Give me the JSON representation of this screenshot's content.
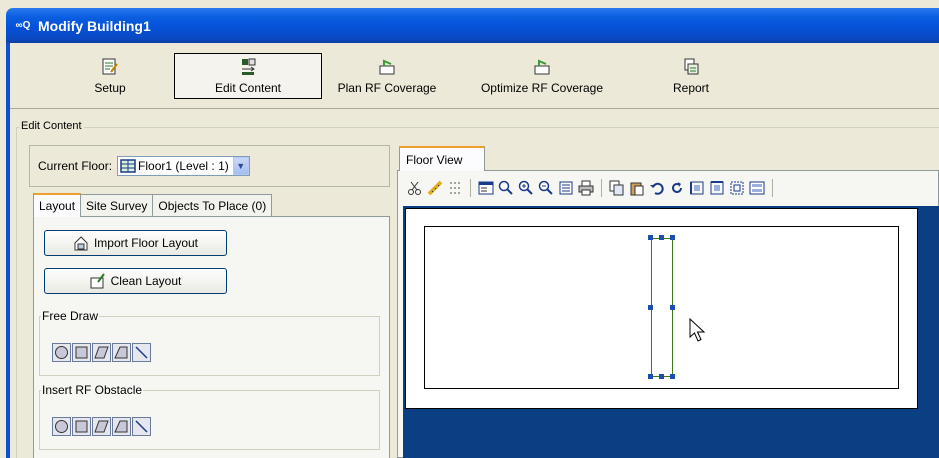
{
  "window": {
    "title": "Modify Building1",
    "app_icon": "network-app-icon",
    "app_icon_glyph": "∞Q"
  },
  "toolbar": {
    "items": [
      {
        "label": "Setup",
        "icon": "setup-icon"
      },
      {
        "label": "Edit Content",
        "icon": "edit-content-icon",
        "active": true
      },
      {
        "label": "Plan RF Coverage",
        "icon": "plan-rf-icon"
      },
      {
        "label": "Optimize RF Coverage",
        "icon": "optimize-rf-icon"
      },
      {
        "label": "Report",
        "icon": "report-icon"
      }
    ]
  },
  "edit_content": {
    "group_label": "Edit Content",
    "current_floor_label": "Current Floor:",
    "current_floor_value": "Floor1 (Level : 1)",
    "tabs": [
      {
        "label": "Layout",
        "active": true
      },
      {
        "label": "Site Survey"
      },
      {
        "label": "Objects To Place (0)"
      }
    ],
    "import_floor_layout": "Import Floor Layout",
    "clean_layout": "Clean Layout",
    "free_draw_label": "Free Draw",
    "insert_rf_obstacle_label": "Insert RF Obstacle",
    "shape_tools": [
      "circle-tool-icon",
      "rectangle-tool-icon",
      "parallelogram-tool-icon",
      "trapezoid-tool-icon",
      "line-tool-icon"
    ]
  },
  "floor_view": {
    "tab_label": "Floor View",
    "tools": [
      "cut-icon",
      "ruler-icon",
      "grid-icon",
      "properties-icon",
      "zoom-icon",
      "zoom-in-icon",
      "zoom-out-icon",
      "list-icon",
      "print-icon",
      "copy-icon",
      "paste-icon",
      "undo-icon",
      "refresh-icon",
      "align-left-icon",
      "align-top-icon",
      "fit-icon",
      "layers-icon"
    ]
  },
  "colors": {
    "title_bar": "#0551d9",
    "canvas_bg": "#0a3f84",
    "tab_accent": "#f0a030",
    "wall": "#3a7a1a",
    "handle": "#1a4fb0"
  }
}
